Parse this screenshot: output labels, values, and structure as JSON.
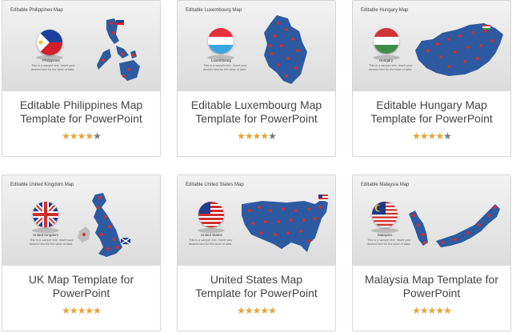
{
  "colors": {
    "map": "#2d5aa0",
    "map_dark": "#1d3f78",
    "pin": "#cf2f2f",
    "star_on": "#e8a33a",
    "star_off": "#7a7a7a"
  },
  "cards": [
    {
      "id": "philippines",
      "thumb_title": "Editable Philippines Map",
      "country_label": "Philippines",
      "sample_text": "This is a sample text. Insert your desired text for the label of data.",
      "title_line1": "Editable Philippines Map",
      "title_line2": "Template for PowerPoint",
      "rating": 3.5,
      "stars": 5
    },
    {
      "id": "luxembourg",
      "thumb_title": "Editable Luxembourg Map",
      "country_label": "Luxembourg",
      "sample_text": "This is a sample text. Insert your desired text for the label of data.",
      "title_line1": "Editable Luxembourg Map",
      "title_line2": "Template for PowerPoint",
      "rating": 3.5,
      "stars": 5
    },
    {
      "id": "hungary",
      "thumb_title": "Editable Hungary Map",
      "country_label": "Hungary",
      "sample_text": "This is a sample text. Insert your desired text for the label of data.",
      "title_line1": "Editable Hungary Map",
      "title_line2": "Template for PowerPoint",
      "rating": 4,
      "stars": 5
    },
    {
      "id": "uk",
      "thumb_title": "Editable United Kingdom Map",
      "country_label": "United Kingdom",
      "sample_text": "This is a sample text. Insert your desired text for the label of data.",
      "title_line1": "UK Map Template for",
      "title_line2": "PowerPoint",
      "rating": 4.5,
      "stars": 5
    },
    {
      "id": "usa",
      "thumb_title": "Editable United States Map",
      "country_label": "United States",
      "sample_text": "This is a sample text. Insert your desired text for the label of data.",
      "title_line1": "United States Map",
      "title_line2": "Template for PowerPoint",
      "rating": 4.5,
      "stars": 5
    },
    {
      "id": "malaysia",
      "thumb_title": "Editable Malaysia Map",
      "country_label": "Malaysia",
      "sample_text": "This is a sample text. Insert your desired text for the label of data.",
      "title_line1": "Malaysia Map Template for",
      "title_line2": "PowerPoint",
      "rating": 5,
      "stars": 5
    }
  ]
}
